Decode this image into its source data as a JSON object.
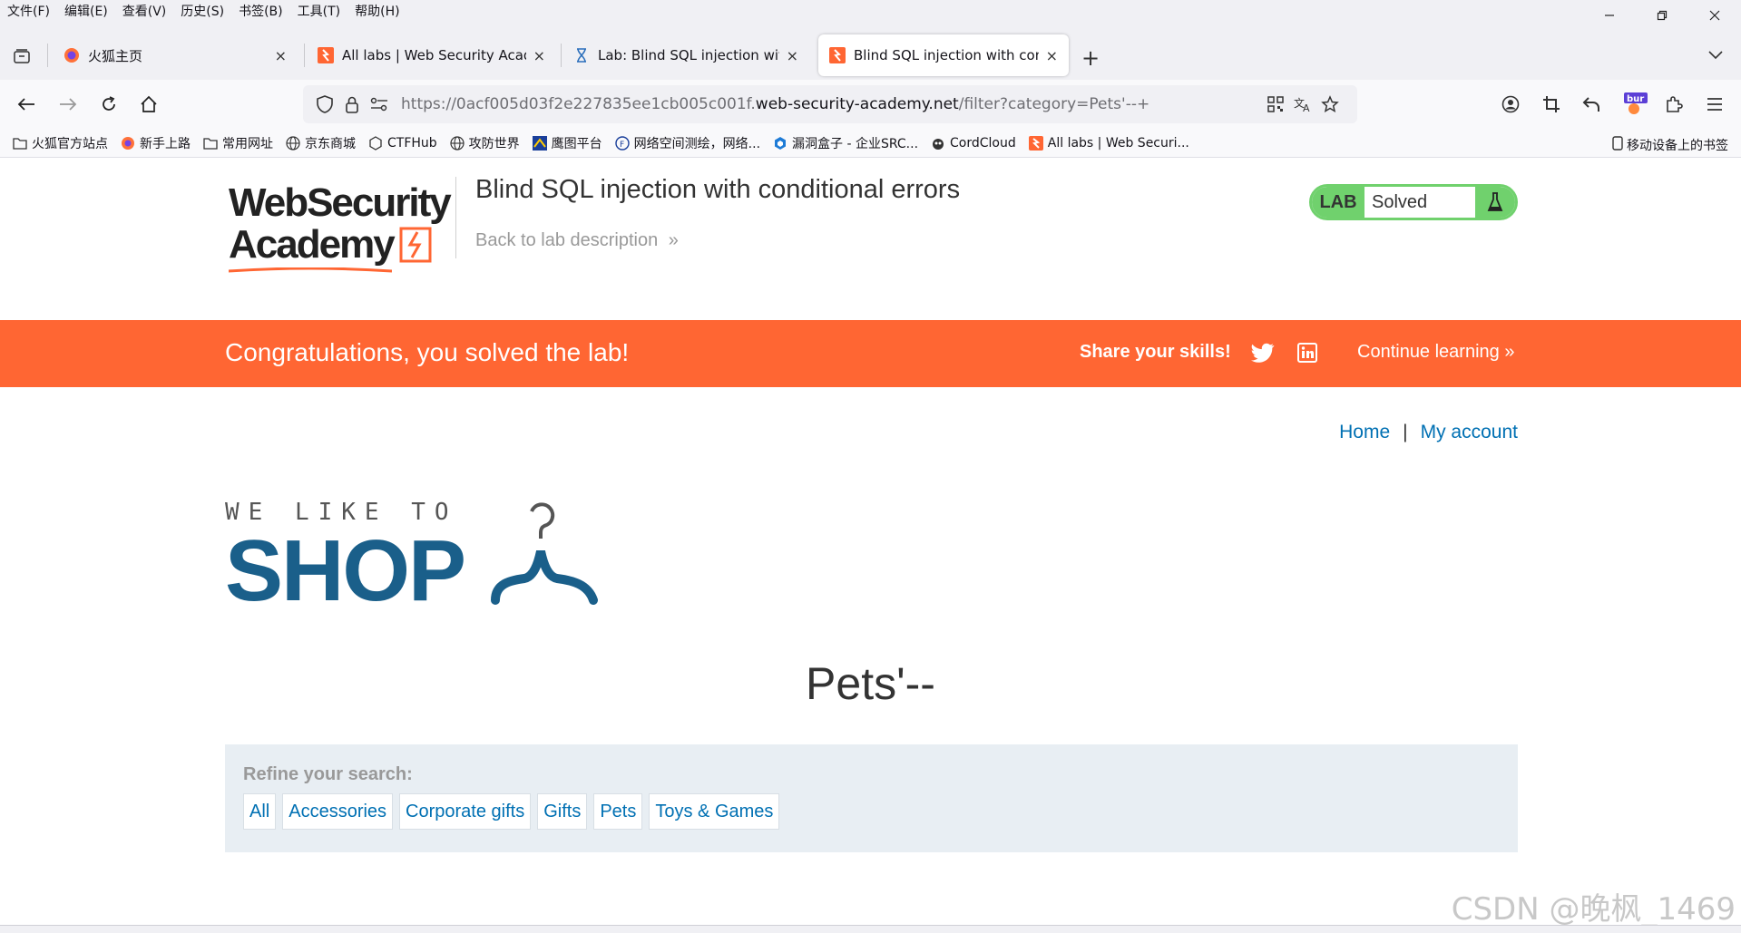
{
  "menubar": {
    "items": [
      "文件(F)",
      "编辑(E)",
      "查看(V)",
      "历史(S)",
      "书签(B)",
      "工具(T)",
      "帮助(H)"
    ]
  },
  "window": {
    "minimize_icon": "minimize-icon",
    "restore_icon": "restore-icon",
    "close_icon": "close-icon"
  },
  "tabs": [
    {
      "title": "火狐主页",
      "icon": "firefox-icon",
      "active": false
    },
    {
      "title": "All labs | Web Security Academy",
      "icon": "portswigger-icon",
      "active": false
    },
    {
      "title": "Lab: Blind SQL injection with conditional errors",
      "icon": "hourglass-icon",
      "active": false
    },
    {
      "title": "Blind SQL injection with conditional errors",
      "icon": "portswigger-icon",
      "active": true
    }
  ],
  "tab_close_glyph": "×",
  "newtab_glyph": "+",
  "url": {
    "prefix": "https://0acf005d03f2e227835ee1cb005c001f.",
    "host": "web-security-academy.net",
    "path": "/filter?category=Pets'--+"
  },
  "bookmarks": [
    {
      "label": "火狐官方站点",
      "icon": "folder-icon"
    },
    {
      "label": "新手上路",
      "icon": "firefox-icon"
    },
    {
      "label": "常用网址",
      "icon": "folder-icon"
    },
    {
      "label": "京东商城",
      "icon": "globe-icon"
    },
    {
      "label": "CTFHub",
      "icon": "ctfhub-icon"
    },
    {
      "label": "攻防世界",
      "icon": "globe-icon"
    },
    {
      "label": "鹰图平台",
      "icon": "hawk-icon"
    },
    {
      "label": "网络空间测绘，网络...",
      "icon": "fofa-icon"
    },
    {
      "label": "漏洞盒子 - 企业SRC...",
      "icon": "vulbox-icon"
    },
    {
      "label": "CordCloud",
      "icon": "cordcloud-icon"
    },
    {
      "label": "All labs | Web Securi...",
      "icon": "portswigger-icon"
    }
  ],
  "bookmarks_mobile": "移动设备上的书签",
  "header": {
    "logo_line1": "WebSecurity",
    "logo_line2": "Academy",
    "lab_title": "Blind SQL injection with conditional errors",
    "back_link": "Back to lab description",
    "badge_lab": "LAB",
    "badge_status": "Solved"
  },
  "congrats": {
    "message": "Congratulations, you solved the lab!",
    "share": "Share your skills!",
    "continue": "Continue learning"
  },
  "nav": {
    "home": "Home",
    "separator": "|",
    "account": "My account"
  },
  "shop": {
    "tagline": "WE LIKE TO",
    "word": "SHOP"
  },
  "category_title": "Pets'--",
  "filters": {
    "label": "Refine your search:",
    "options": [
      "All",
      "Accessories",
      "Corporate gifts",
      "Gifts",
      "Pets",
      "Toys & Games"
    ]
  },
  "watermark": "CSDN @晚枫_1469",
  "colors": {
    "accent": "#ff6633",
    "link": "#0070b3",
    "solved": "#70d16d",
    "shop_blue": "#1a5f8a"
  }
}
